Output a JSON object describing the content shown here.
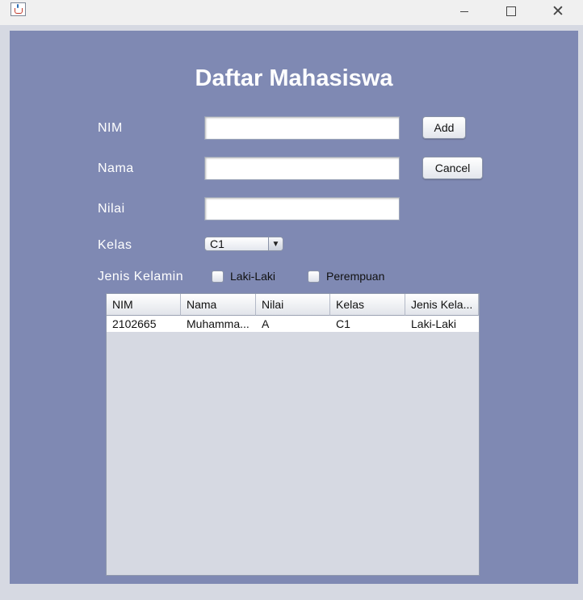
{
  "window": {
    "title_icon": "java-cup-icon",
    "controls": [
      "minimize-icon",
      "maximize-icon",
      "close-icon"
    ]
  },
  "form": {
    "title": "Daftar Mahasiswa",
    "nim_label": "NIM",
    "nim_value": "",
    "nama_label": "Nama",
    "nama_value": "",
    "nilai_label": "Nilai",
    "nilai_value": "",
    "kelas_label": "Kelas",
    "kelas_selected": "C1",
    "jenis_kelamin_label": "Jenis Kelamin",
    "option_male": "Laki-Laki",
    "option_female": "Perempuan",
    "male_checked": false,
    "female_checked": false,
    "add_label": "Add",
    "cancel_label": "Cancel"
  },
  "table": {
    "columns": [
      "NIM",
      "Nama",
      "Nilai",
      "Kelas",
      "Jenis Kela..."
    ],
    "rows": [
      [
        "2102665",
        "Muhamma...",
        "A",
        "C1",
        "Laki-Laki"
      ]
    ]
  },
  "colors": {
    "panel_bg": "#7f89b3",
    "window_bg": "#d6d9e2"
  }
}
